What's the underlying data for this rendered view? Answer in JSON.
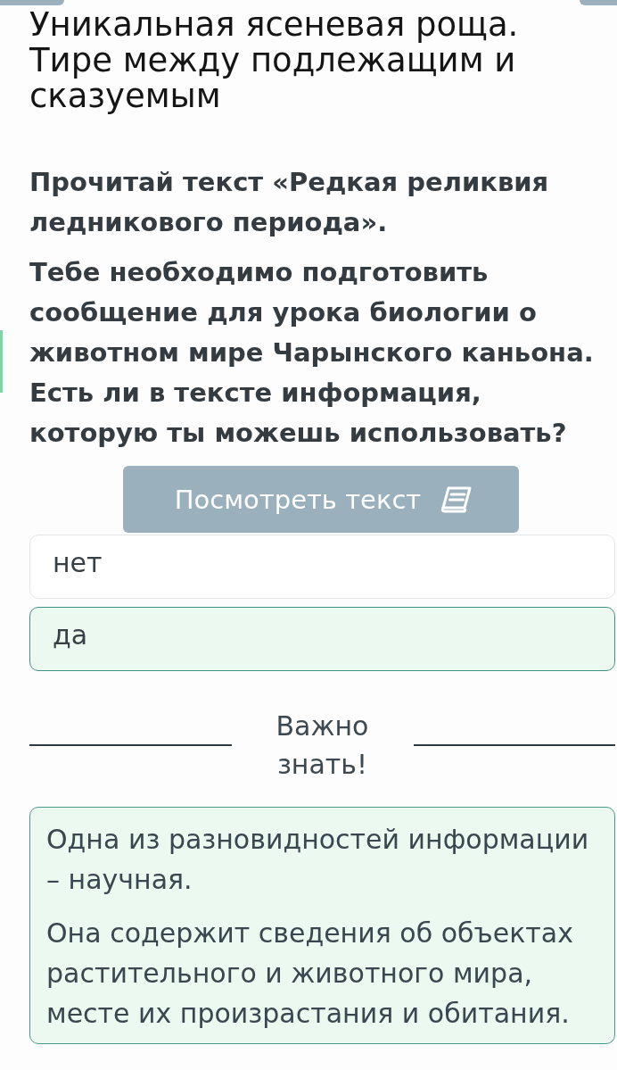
{
  "header": {
    "title": "Уникальная ясеневая роща. Тире между подлежащим и сказуемым"
  },
  "task": {
    "paragraphs": [
      "Прочитай текст «Редкая реликвия ледникового периода».",
      "Тебе необходимо подготовить сообщение для урока биологии о животном мире Чарынского каньона. Есть ли в тексте информация, которую ты можешь использовать?"
    ],
    "view_button": {
      "label": "Посмотреть текст"
    }
  },
  "options": [
    {
      "label": "нет",
      "selected": false
    },
    {
      "label": "да",
      "selected": true
    }
  ],
  "note": {
    "heading": "Важно знать!",
    "paragraphs": [
      "Одна из разновидностей информации – научная.",
      "Она содержит сведения об объектах растительного и животного мира, месте их произрастания и обитания."
    ]
  }
}
